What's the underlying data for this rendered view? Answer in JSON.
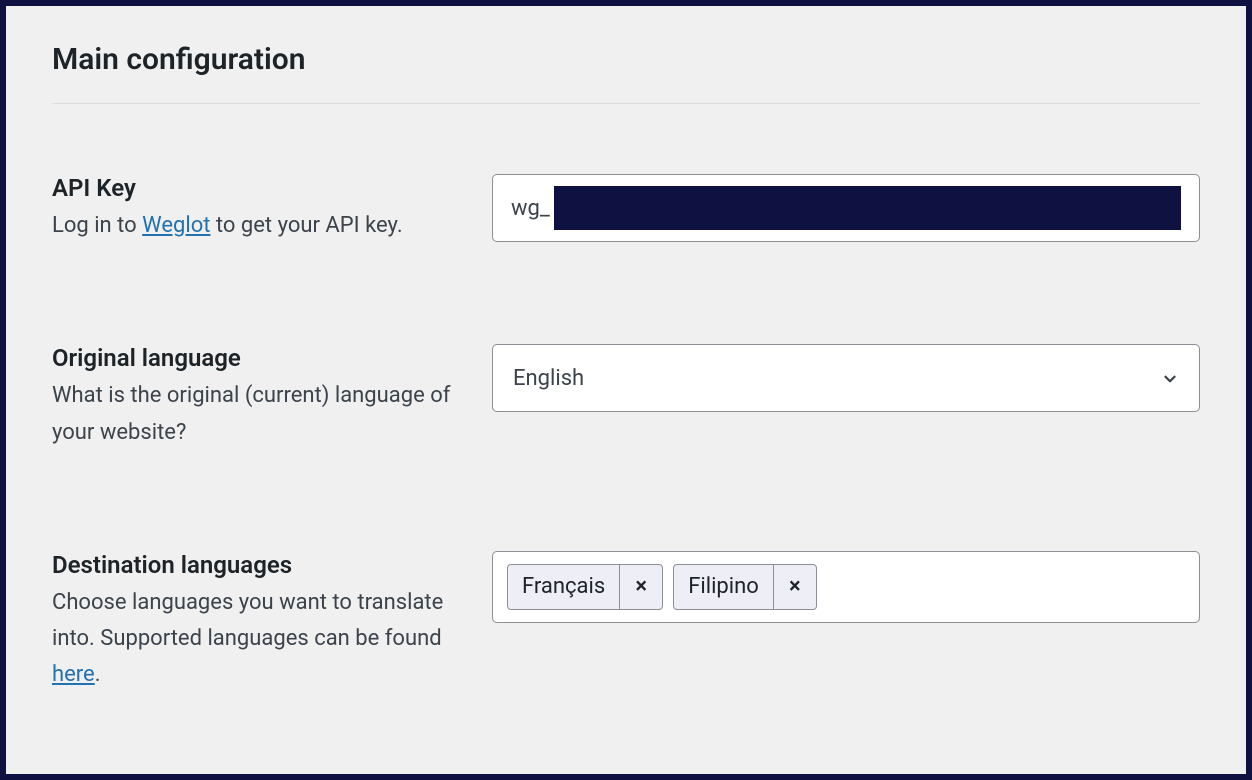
{
  "section": {
    "title": "Main configuration"
  },
  "api_key": {
    "label": "API Key",
    "desc_prefix": "Log in to ",
    "desc_link": "Weglot",
    "desc_suffix": " to get your API key.",
    "value_prefix": "wg_"
  },
  "original_language": {
    "label": "Original language",
    "desc": "What is the original (current) language of your website?",
    "value": "English"
  },
  "destination_languages": {
    "label": "Destination languages",
    "desc_prefix": "Choose languages you want to translate into. Supported languages can be found ",
    "desc_link": "here",
    "desc_suffix": ".",
    "tags": [
      {
        "label": "Français"
      },
      {
        "label": "Filipino"
      }
    ]
  }
}
